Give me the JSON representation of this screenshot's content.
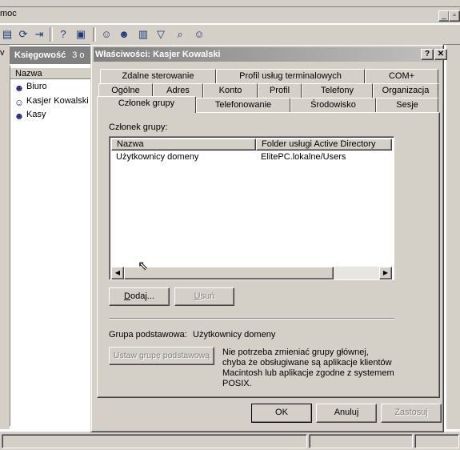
{
  "background": {
    "menu_help": "moc",
    "header_title": "Księgowość",
    "header_count": "3 o",
    "left_letter": "v",
    "list_column": "Nazwa",
    "list_items": [
      "Biuro",
      "Kasjer Kowalski",
      "Kasy"
    ],
    "toolbar_icons": [
      "properties-icon",
      "refresh-icon",
      "export-icon",
      "help-icon",
      "console-icon",
      "new-user-icon",
      "new-group-icon",
      "new-ou-icon",
      "filter-icon",
      "find-icon",
      "add-to-group-icon"
    ]
  },
  "dialog": {
    "title": "Właściwości: Kasjer Kowalski",
    "help_btn": "?",
    "close_btn": "✕",
    "tabs_row1": [
      "Zdalne sterowanie",
      "Profil usług terminalowych",
      "COM+"
    ],
    "tabs_row2": [
      "Ogólne",
      "Adres",
      "Konto",
      "Profil",
      "Telefony",
      "Organizacja"
    ],
    "tabs_row3": [
      "Członek grupy",
      "Telefonowanie",
      "Środowisko",
      "Sesje"
    ],
    "active_tab": "Członek grupy",
    "member_of_label": "Członek grupy:",
    "columns": [
      "Nazwa",
      "Folder usługi Active Directory"
    ],
    "rows": [
      {
        "name": "Użytkownicy domeny",
        "folder": "ElitePC.lokalne/Users"
      }
    ],
    "add_btn_prefix": "D",
    "add_btn_rest": "odaj...",
    "remove_btn_prefix": "U",
    "remove_btn_rest": "suń",
    "primary_label": "Grupa podstawowa:",
    "primary_value": "Użytkownicy domeny",
    "set_primary_btn": "Ustaw grupę podstawową",
    "note": "Nie potrzeba zmieniać grupy głównej, chyba że obsługiwane są aplikacje klientów Macintosh lub aplikacje zgodne z systemem POSIX.",
    "ok_btn": "OK",
    "cancel_btn": "Anuluj",
    "apply_btn": "Zastosuj"
  }
}
